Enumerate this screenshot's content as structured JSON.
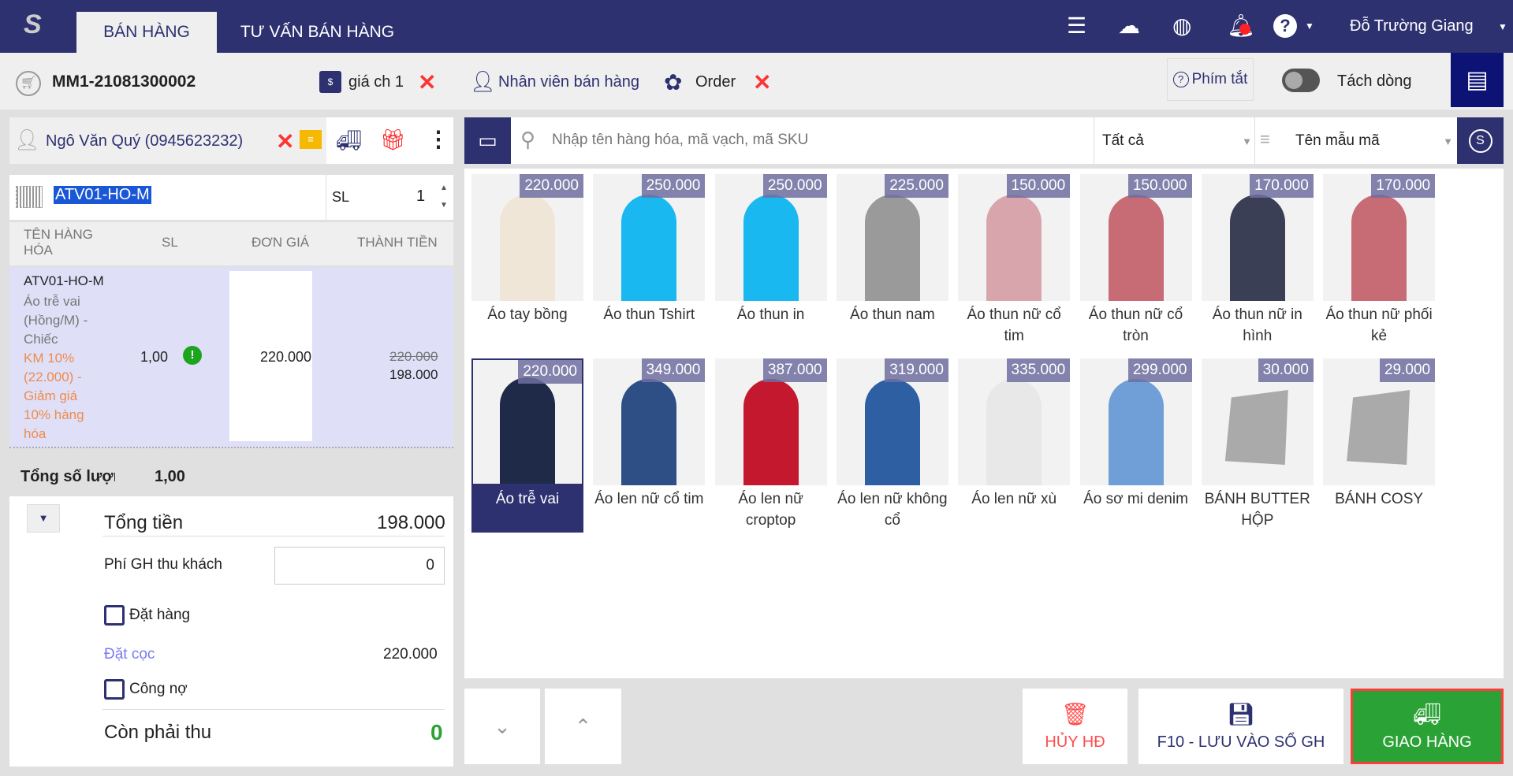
{
  "header": {
    "tabs": [
      "BÁN HÀNG",
      "TƯ VẤN BÁN HÀNG"
    ],
    "user": "Đỗ Trường Giang"
  },
  "toolbar": {
    "invoice_code": "MM1-21081300002",
    "price_book": "giá ch 1",
    "staff": "Nhân viên bán hàng",
    "order": "Order",
    "shortcut": "Phím tắt",
    "split_line": "Tách dòng"
  },
  "customer": {
    "name": "Ngô Văn Quý (0945623232)"
  },
  "barcode": {
    "value": "ATV01-HO-M",
    "qty_label": "SL",
    "qty": "1"
  },
  "cart": {
    "headers": [
      "TÊN HÀNG HÓA",
      "SL",
      "ĐƠN GIÁ",
      "THÀNH TIỀN"
    ],
    "items": [
      {
        "code": "ATV01-HO-M",
        "name": "Áo trễ vai (Hồng/M) - Chiếc",
        "promo": "KM 10% (22.000) - Giảm giá 10% hàng hóa",
        "qty": "1,00",
        "unit_price": "220.000",
        "old_total": "220.000",
        "total": "198.000"
      }
    ]
  },
  "summary": {
    "total_qty_label": "Tổng số lượng",
    "total_qty": "1,00",
    "total_label": "Tổng tiền",
    "total": "198.000",
    "ship_fee_label": "Phí GH thu khách",
    "ship_fee": "0",
    "order_label": "Đặt hàng",
    "deposit_label": "Đặt cọc",
    "deposit": "220.000",
    "debt_label": "Công nợ",
    "remaining_label": "Còn phải thu",
    "remaining": "0"
  },
  "search": {
    "placeholder": "Nhập tên hàng hóa, mã vạch, mã SKU",
    "category": "Tất cả",
    "sort": "Tên mẫu mã"
  },
  "products": [
    {
      "name": "Áo tay bồng",
      "price": "220.000",
      "color": "#efe6d8"
    },
    {
      "name": "Áo thun Tshirt",
      "price": "250.000",
      "color": "#19b8f0"
    },
    {
      "name": "Áo thun in",
      "price": "250.000",
      "color": "#19b8f0"
    },
    {
      "name": "Áo thun nam",
      "price": "225.000",
      "color": "#9a9a9a"
    },
    {
      "name": "Áo thun nữ cổ tim",
      "price": "150.000",
      "color": "#d9a5ad"
    },
    {
      "name": "Áo thun nữ cổ tròn",
      "price": "150.000",
      "color": "#c76b75"
    },
    {
      "name": "Áo thun nữ in hình",
      "price": "170.000",
      "color": "#3b3f55"
    },
    {
      "name": "Áo thun nữ phối kẻ",
      "price": "170.000",
      "color": "#c76b75"
    },
    {
      "name": "Áo trễ vai",
      "price": "220.000",
      "color": "#1e2a48"
    },
    {
      "name": "Áo len nữ cổ tim",
      "price": "349.000",
      "color": "#2e4f86"
    },
    {
      "name": "Áo len nữ croptop",
      "price": "387.000",
      "color": "#c4182e"
    },
    {
      "name": "Áo len nữ không cổ",
      "price": "319.000",
      "color": "#2f5fa3"
    },
    {
      "name": "Áo len nữ xù",
      "price": "335.000",
      "color": "#e8e8e8"
    },
    {
      "name": "Áo sơ mi denim",
      "price": "299.000",
      "color": "#6f9fd6"
    },
    {
      "name": "BÁNH BUTTER HỘP",
      "price": "30.000",
      "color": ""
    },
    {
      "name": "BÁNH COSY",
      "price": "29.000",
      "color": ""
    }
  ],
  "actions": {
    "cancel": "HỦY HĐ",
    "save": "F10 - LƯU VÀO SỔ GH",
    "deliver": "GIAO HÀNG"
  },
  "colors": {
    "brand": "#2d3170",
    "danger": "#ff4d4d",
    "success": "#2aa235",
    "promo": "#f08a4b"
  }
}
